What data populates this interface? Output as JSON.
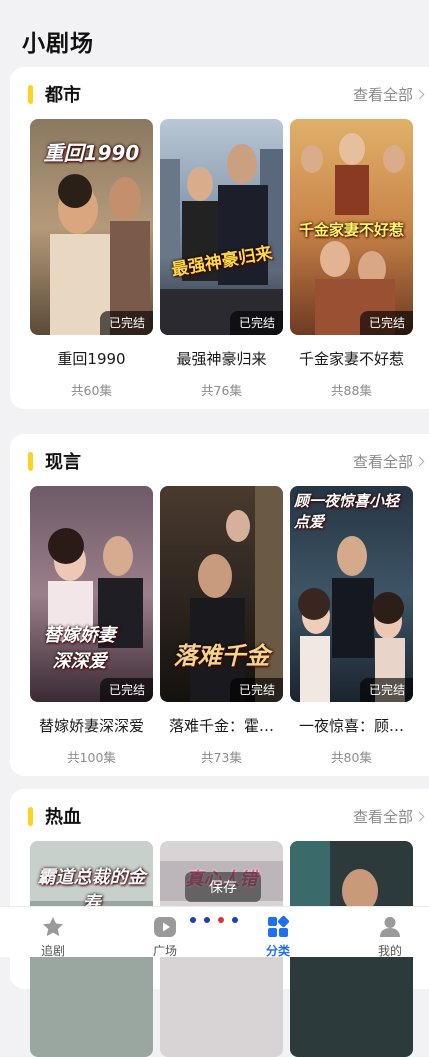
{
  "page": {
    "title": "小剧场"
  },
  "sections": [
    {
      "title": "都市",
      "more": "查看全部",
      "cards": [
        {
          "poster_text": "重回1990",
          "badge": "已完结",
          "name": "重回1990",
          "count": "共60集"
        },
        {
          "poster_text": "最强神豪归来",
          "badge": "已完结",
          "name": "最强神豪归来",
          "count": "共76集"
        },
        {
          "poster_text": "千金家妻不好惹",
          "badge": "已完结",
          "name": "千金家妻不好惹",
          "count": "共88集"
        }
      ]
    },
    {
      "title": "现言",
      "more": "查看全部",
      "cards": [
        {
          "poster_text": "替嫁娇妻深深爱",
          "badge": "已完结",
          "name": "替嫁娇妻深深爱",
          "count": "共100集"
        },
        {
          "poster_text": "落难千金",
          "badge": "已完结",
          "name": "落难千金：霍…",
          "count": "共73集"
        },
        {
          "poster_text": "顾一夜惊喜小轻点爱",
          "badge": "已完结",
          "name": "一夜惊喜：顾…",
          "count": "共80集"
        }
      ]
    },
    {
      "title": "热血",
      "more": "查看全部",
      "cards": [
        {
          "poster_text": "霸道总裁的金寿"
        },
        {
          "poster_text": "真心人错"
        },
        {
          "poster_text": ""
        }
      ]
    }
  ],
  "toast": "保存",
  "nav": [
    {
      "label": "追剧",
      "icon": "star-icon"
    },
    {
      "label": "广场",
      "icon": "play-icon"
    },
    {
      "label": "分类",
      "icon": "category-icon",
      "active": true
    },
    {
      "label": "我的",
      "icon": "user-icon"
    }
  ],
  "colors": {
    "accent": "#ffd21e",
    "active": "#1f6ff0"
  }
}
